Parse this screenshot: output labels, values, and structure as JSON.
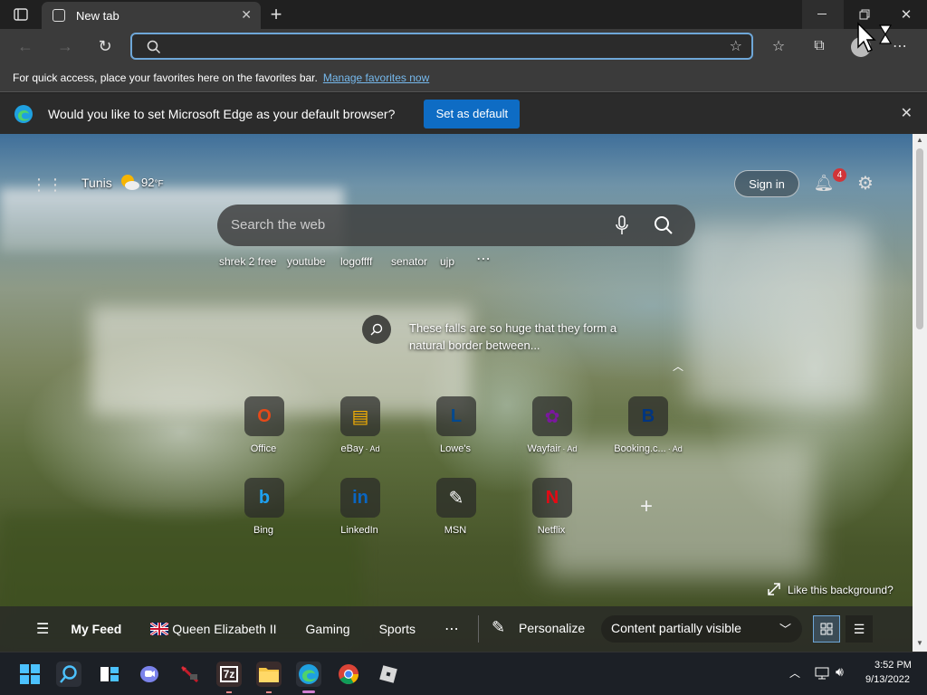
{
  "browser": {
    "tab_title": "New tab",
    "address_value": "",
    "favorites_bar_text": "For quick access, place your favorites here on the favorites bar.",
    "favorites_bar_link": "Manage favorites now",
    "infobar_text": "Would you like to set Microsoft Edge as your default browser?",
    "infobar_button": "Set as default"
  },
  "newtab": {
    "location": "Tunis",
    "temperature": "92",
    "temp_unit": "°F",
    "sign_in": "Sign in",
    "notification_count": "4",
    "search_placeholder": "Search the web",
    "quick_searches": [
      "shrek 2 free",
      "youtube",
      "logoffff",
      "senator",
      "ujp"
    ],
    "bg_caption": "These falls are so huge that they form a natural border between...",
    "tiles": [
      {
        "label": "Office",
        "ad": "",
        "icon": "office-icon",
        "glyph": "O",
        "color": "#e64a19"
      },
      {
        "label": "eBay",
        "ad": "· Ad",
        "icon": "ebay-icon",
        "glyph": "▤",
        "color": "#f5af02"
      },
      {
        "label": "Lowe's",
        "ad": "",
        "icon": "lowes-icon",
        "glyph": "L",
        "color": "#004990"
      },
      {
        "label": "Wayfair",
        "ad": "· Ad",
        "icon": "wayfair-icon",
        "glyph": "✿",
        "color": "#7b189f"
      },
      {
        "label": "Booking.c...",
        "ad": "· Ad",
        "icon": "booking-icon",
        "glyph": "B",
        "color": "#003580"
      },
      {
        "label": "Bing",
        "ad": "",
        "icon": "bing-icon",
        "glyph": "b",
        "color": "#1ea1f1"
      },
      {
        "label": "LinkedIn",
        "ad": "",
        "icon": "linkedin-icon",
        "glyph": "in",
        "color": "#0a66c2"
      },
      {
        "label": "MSN",
        "ad": "",
        "icon": "msn-icon",
        "glyph": "✎",
        "color": "#ffffff"
      },
      {
        "label": "Netflix",
        "ad": "",
        "icon": "netflix-icon",
        "glyph": "N",
        "color": "#e50914"
      }
    ],
    "like_background": "Like this background?",
    "feed": {
      "my_feed": "My Feed",
      "queen": "Queen Elizabeth II",
      "gaming": "Gaming",
      "sports": "Sports",
      "personalize": "Personalize",
      "content_visibility": "Content partially visible"
    }
  },
  "taskbar": {
    "time": "3:52 PM",
    "date": "9/13/2022"
  }
}
